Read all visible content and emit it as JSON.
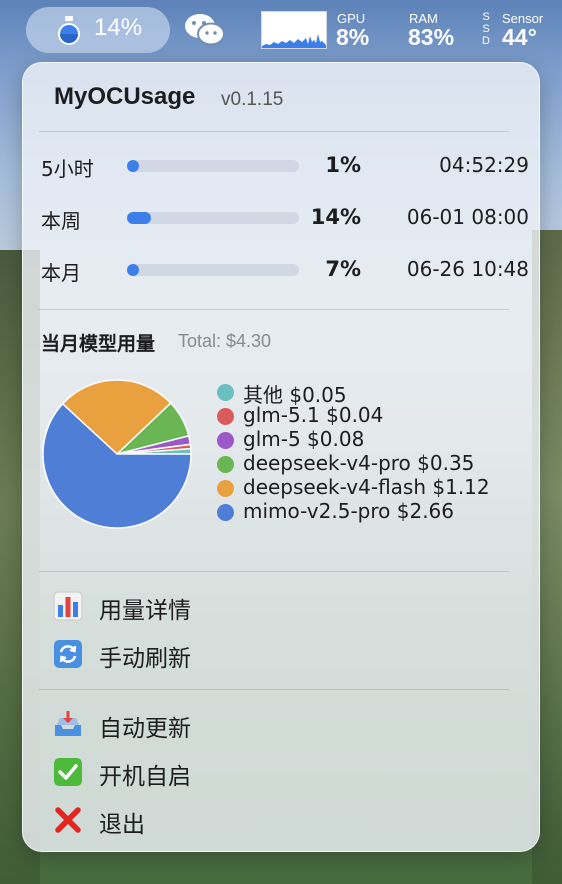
{
  "menubar": {
    "battery_percent": "14%",
    "gpu_label": "GPU",
    "gpu_value": "8%",
    "ram_label": "RAM",
    "ram_value": "83%",
    "ssd_letters": [
      "S",
      "S",
      "D"
    ],
    "sensor_label": "Sensor",
    "sensor_value": "44°"
  },
  "app": {
    "title": "MyOCUsage",
    "version": "v0.1.15"
  },
  "usage": [
    {
      "label": "5小时",
      "percent_text": "1%",
      "fill_percent": 1,
      "reset_time": "04:52:29"
    },
    {
      "label": "本周",
      "percent_text": "14%",
      "fill_percent": 14,
      "reset_time": "06-01 08:00"
    },
    {
      "label": "本月",
      "percent_text": "7%",
      "fill_percent": 7,
      "reset_time": "06-26 10:48"
    }
  ],
  "models": {
    "title": "当月模型用量",
    "total": "Total: $4.30"
  },
  "chart_data": {
    "type": "pie",
    "slices": [
      {
        "name": "其他",
        "value": 0.05,
        "label": "其他  $0.05",
        "color": "#6bbfbf"
      },
      {
        "name": "glm-5.1",
        "value": 0.04,
        "label": "glm-5.1  $0.04",
        "color": "#d95c5c"
      },
      {
        "name": "glm-5",
        "value": 0.08,
        "label": "glm-5  $0.08",
        "color": "#9b59c8"
      },
      {
        "name": "deepseek-v4-pro",
        "value": 0.35,
        "label": "deepseek-v4-pro  $0.35",
        "color": "#6ab654"
      },
      {
        "name": "deepseek-v4-flash",
        "value": 1.12,
        "label": "deepseek-v4-flash  $1.12",
        "color": "#e9a13f"
      },
      {
        "name": "mimo-v2.5-pro",
        "value": 2.66,
        "label": "mimo-v2.5-pro  $2.66",
        "color": "#4f7ed6"
      }
    ]
  },
  "menu": {
    "details": "用量详情",
    "refresh": "手动刷新",
    "auto_update": "自动更新",
    "launch_at_login": "开机自启",
    "quit": "退出"
  }
}
